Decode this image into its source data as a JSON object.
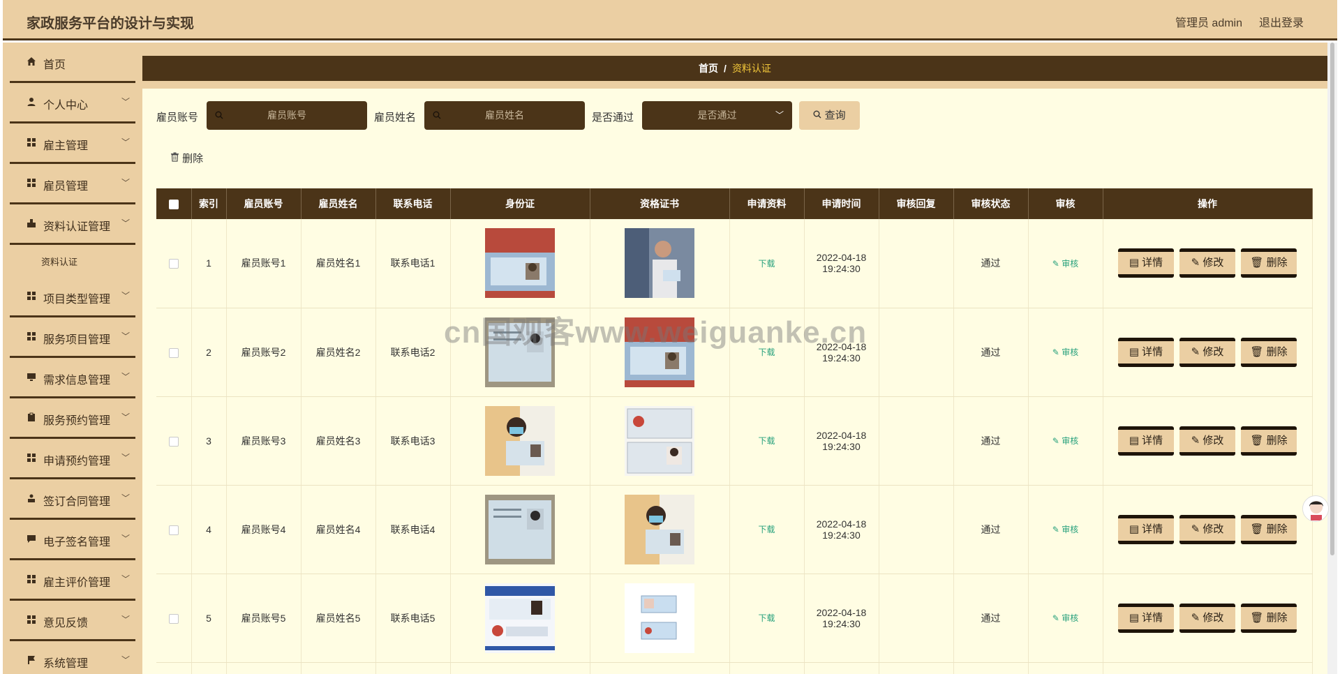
{
  "header": {
    "title": "家政服务平台的设计与实现",
    "admin": "管理员 admin",
    "logout": "退出登录"
  },
  "sidebar": {
    "items": [
      {
        "label": "首页",
        "icon": "home-icon",
        "chevron": false
      },
      {
        "label": "个人中心",
        "icon": "user-icon",
        "chevron": true
      },
      {
        "label": "雇主管理",
        "icon": "grid-icon",
        "chevron": true
      },
      {
        "label": "雇员管理",
        "icon": "grid-icon",
        "chevron": true
      },
      {
        "label": "资料认证管理",
        "icon": "stamp-icon",
        "chevron": true
      },
      {
        "label": "项目类型管理",
        "icon": "grid-icon",
        "chevron": true
      },
      {
        "label": "服务项目管理",
        "icon": "grid-icon",
        "chevron": true
      },
      {
        "label": "需求信息管理",
        "icon": "monitor-icon",
        "chevron": true
      },
      {
        "label": "服务预约管理",
        "icon": "clipboard-icon",
        "chevron": true
      },
      {
        "label": "申请预约管理",
        "icon": "grid-icon",
        "chevron": true
      },
      {
        "label": "签订合同管理",
        "icon": "person-icon",
        "chevron": true
      },
      {
        "label": "电子签名管理",
        "icon": "chat-icon",
        "chevron": true
      },
      {
        "label": "雇主评价管理",
        "icon": "grid-icon",
        "chevron": true
      },
      {
        "label": "意见反馈",
        "icon": "grid-icon",
        "chevron": true
      },
      {
        "label": "系统管理",
        "icon": "flag-icon",
        "chevron": true
      }
    ],
    "submenu": {
      "label": "资料认证"
    }
  },
  "breadcrumb": {
    "home": "首页",
    "sep": "/",
    "current": "资料认证"
  },
  "search": {
    "label_account": "雇员账号",
    "placeholder_account": "雇员账号",
    "label_name": "雇员姓名",
    "placeholder_name": "雇员姓名",
    "label_pass": "是否通过",
    "placeholder_pass": "是否通过",
    "query_label": "查询"
  },
  "toolbar": {
    "delete_label": "删除"
  },
  "table": {
    "headers": [
      "索引",
      "雇员账号",
      "雇员姓名",
      "联系电话",
      "身份证",
      "资格证书",
      "申请资料",
      "申请时间",
      "审核回复",
      "审核状态",
      "审核",
      "操作"
    ],
    "rows": [
      {
        "index": "1",
        "account": "雇员账号1",
        "name": "雇员姓名1",
        "phone": "联系电话1",
        "download": "下载",
        "time_date": "2022-04-18",
        "time_clock": "19:24:30",
        "reply": "",
        "status": "通过",
        "audit": "审核"
      },
      {
        "index": "2",
        "account": "雇员账号2",
        "name": "雇员姓名2",
        "phone": "联系电话2",
        "download": "下载",
        "time_date": "2022-04-18",
        "time_clock": "19:24:30",
        "reply": "",
        "status": "通过",
        "audit": "审核"
      },
      {
        "index": "3",
        "account": "雇员账号3",
        "name": "雇员姓名3",
        "phone": "联系电话3",
        "download": "下载",
        "time_date": "2022-04-18",
        "time_clock": "19:24:30",
        "reply": "",
        "status": "通过",
        "audit": "审核"
      },
      {
        "index": "4",
        "account": "雇员账号4",
        "name": "雇员姓名4",
        "phone": "联系电话4",
        "download": "下载",
        "time_date": "2022-04-18",
        "time_clock": "19:24:30",
        "reply": "",
        "status": "通过",
        "audit": "审核"
      },
      {
        "index": "5",
        "account": "雇员账号5",
        "name": "雇员姓名5",
        "phone": "联系电话5",
        "download": "下载",
        "time_date": "2022-04-18",
        "time_clock": "19:24:30",
        "reply": "",
        "status": "通过",
        "audit": "审核"
      }
    ],
    "actions": {
      "detail": "详情",
      "edit": "修改",
      "delete": "删除"
    }
  },
  "watermark": "cn国观客www.weiguanke.cn",
  "colors": {
    "header_bg": "#ebcfa3",
    "dark_brown": "#4b3418",
    "content_bg": "#fffde3",
    "accent_yellow": "#f3c83a",
    "link_green": "#27a17c"
  }
}
